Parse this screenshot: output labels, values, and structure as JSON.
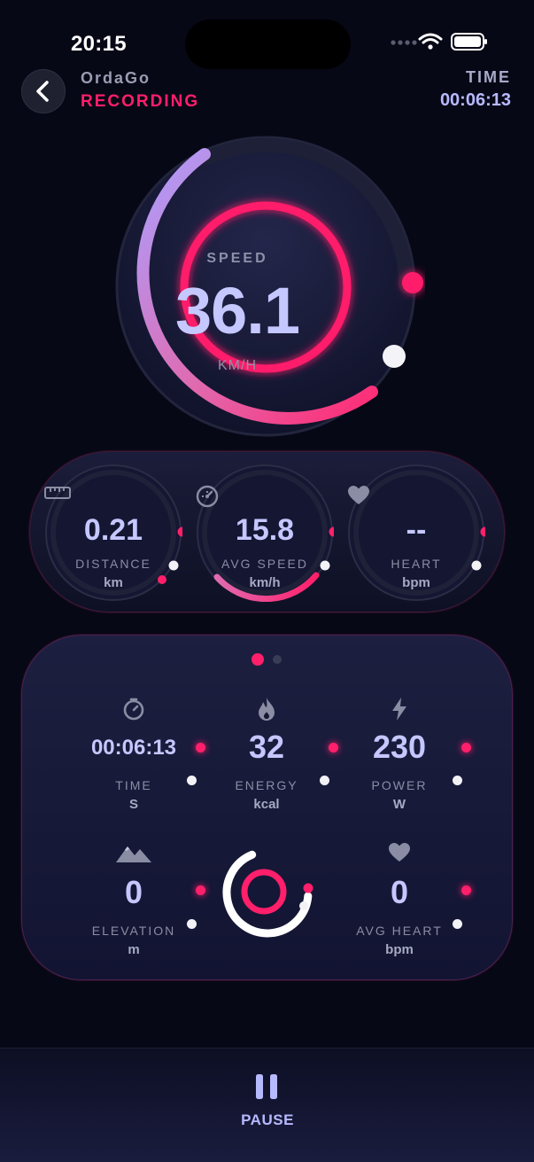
{
  "status_bar": {
    "time": "20:15"
  },
  "header": {
    "app_name": "OrdaGo",
    "state": "RECORDING",
    "time_label": "TIME",
    "time_value": "00:06:13"
  },
  "speed": {
    "label": "SPEED",
    "value": "36.1",
    "unit": "KM/H"
  },
  "mini_gauges": [
    {
      "label": "DISTANCE",
      "value": "0.21",
      "unit": "km",
      "icon": "ruler-icon"
    },
    {
      "label": "AVG SPEED",
      "value": "15.8",
      "unit": "km/h",
      "icon": "speedometer-icon"
    },
    {
      "label": "HEART",
      "value": "--",
      "unit": "bpm",
      "icon": "heart-icon"
    }
  ],
  "stats": [
    {
      "label": "TIME",
      "value": "00:06:13",
      "unit": "S",
      "icon": "timer-icon"
    },
    {
      "label": "ENERGY",
      "value": "32",
      "unit": "kcal",
      "icon": "flame-icon"
    },
    {
      "label": "POWER",
      "value": "230",
      "unit": "W",
      "icon": "bolt-icon"
    },
    {
      "label": "ELEVATION",
      "value": "0",
      "unit": "m",
      "icon": "mountain-icon"
    },
    {
      "label": "AVG HEART",
      "value": "0",
      "unit": "bpm",
      "icon": "heart-icon"
    }
  ],
  "pager": {
    "pages": 2,
    "active": 1
  },
  "bottom": {
    "pause_label": "PAUSE"
  },
  "colors": {
    "accent": "#ff1f6a",
    "value_text": "#c5c7ff",
    "background": "#070816",
    "gauge_gradient_start": "#b9a4ff",
    "gauge_gradient_end": "#ff1f6a"
  }
}
